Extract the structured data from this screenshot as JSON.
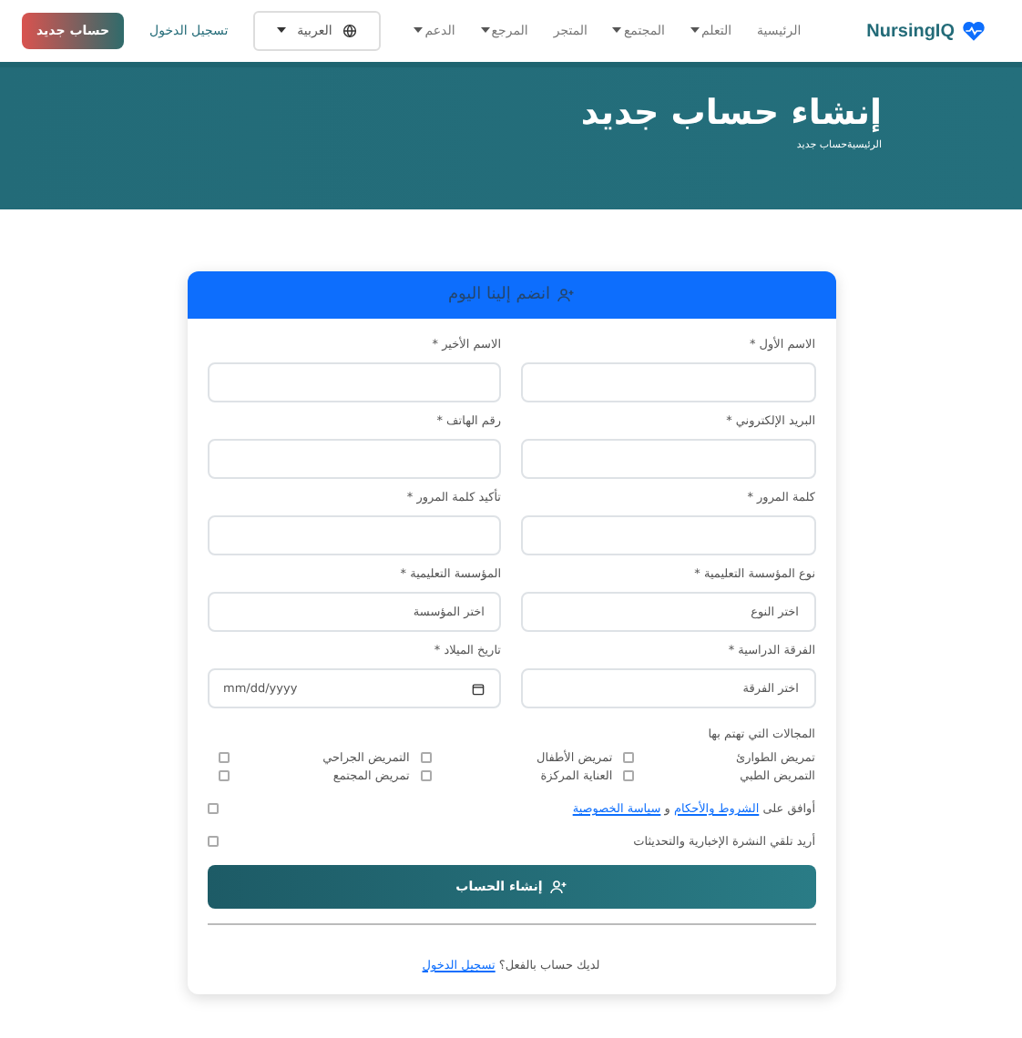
{
  "navbar": {
    "brand": "NursingIQ",
    "links": [
      {
        "label": "الرئيسية",
        "dropdown": false
      },
      {
        "label": "التعلم",
        "dropdown": true
      },
      {
        "label": "المجتمع",
        "dropdown": true
      },
      {
        "label": "المتجر",
        "dropdown": false
      },
      {
        "label": "المرجع",
        "dropdown": true
      },
      {
        "label": "الدعم",
        "dropdown": true
      }
    ],
    "language": "العربية",
    "login": "تسجيل الدخول",
    "signup": "حساب جديد"
  },
  "hero": {
    "title": "إنشاء حساب جديد",
    "breadcrumb": [
      "الرئيسية",
      "حساب جديد"
    ]
  },
  "form": {
    "title": "انضم إلينا اليوم",
    "fields": [
      {
        "label": "الاسم الأول *",
        "kind": "text"
      },
      {
        "label": "الاسم الأخير *",
        "kind": "text"
      },
      {
        "label": "البريد الإلكتروني *",
        "kind": "text"
      },
      {
        "label": "رقم الهاتف *",
        "kind": "text"
      },
      {
        "label": "كلمة المرور *",
        "kind": "text"
      },
      {
        "label": "تأكيد كلمة المرور *",
        "kind": "text"
      },
      {
        "label": "نوع المؤسسة التعليمية *",
        "kind": "select",
        "value": "اختر النوع"
      },
      {
        "label": "المؤسسة التعليمية *",
        "kind": "select",
        "value": "اختر المؤسسة"
      },
      {
        "label": "الفرقة الدراسية *",
        "kind": "select",
        "value": "اختر الفرقة"
      },
      {
        "label": "تاريخ الميلاد *",
        "kind": "date",
        "placeholder": "mm/dd/yyyy"
      }
    ],
    "interests_label": "المجالات التي تهتم بها",
    "interests": [
      {
        "label": "تمريض الطوارئ",
        "checked": false
      },
      {
        "label": "تمريض الأطفال",
        "checked": false
      },
      {
        "label": "التمريض الجراحي",
        "checked": false
      },
      {
        "label": "التمريض الطبي",
        "checked": false
      },
      {
        "label": "العناية المركزة",
        "checked": false
      },
      {
        "label": "تمريض المجتمع",
        "checked": false
      }
    ],
    "terms": {
      "checked": false,
      "prefix": "أوافق على",
      "terms_link": "الشروط والأحكام",
      "joiner": "و",
      "privacy_link": "سياسة الخصوصية"
    },
    "newsletter": {
      "checked": false,
      "label": "أريد تلقي النشرة الإخبارية والتحديثات"
    },
    "submit": "إنشاء الحساب",
    "footer": {
      "text": "لديك حساب بالفعل؟",
      "link": "تسجيل الدخول"
    }
  }
}
